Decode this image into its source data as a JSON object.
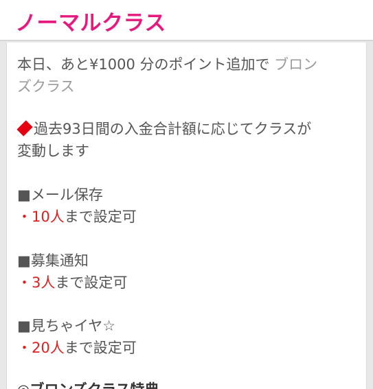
{
  "header": {
    "title": "ノーマルクラス"
  },
  "content": {
    "points_line1": "本日、あと¥1000 分のポイント追加で",
    "next_class_part1": "ブロン",
    "next_class_part2": "ズクラス",
    "info_line1": "過去93日間の入金合計額に応じてクラスが",
    "info_line2": "変動します",
    "sections": [
      {
        "title": "■メール保存",
        "bullet": "・",
        "count": "10人",
        "suffix": "まで設定可"
      },
      {
        "title": "■募集通知",
        "bullet": "・",
        "count": "3人",
        "suffix": "まで設定可"
      },
      {
        "title": "■見ちゃイヤ☆",
        "bullet": "・",
        "count": "20人",
        "suffix": "まで設定可"
      }
    ],
    "bronze_heading": "◎ブロンズクラス特典"
  },
  "colors": {
    "accent": "#e6197e",
    "highlight": "#e02020"
  }
}
